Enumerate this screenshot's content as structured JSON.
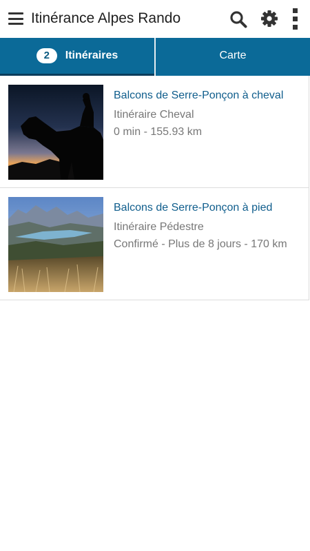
{
  "app": {
    "title": "Itinérance Alpes Rando",
    "icons": {
      "menu": "hamburger-menu-icon",
      "search": "search-icon",
      "settings": "gear-icon",
      "overflow": "more-vertical-icon"
    }
  },
  "tabs": {
    "itineraires": {
      "count": "2",
      "label": "Itinéraires"
    },
    "carte": {
      "label": "Carte"
    }
  },
  "routes": [
    {
      "title": "Balcons de Serre-Ponçon à cheval",
      "type": "Itinéraire Cheval",
      "meta": "0 min - 155.93 km"
    },
    {
      "title": "Balcons de Serre-Ponçon à pied",
      "type": "Itinéraire Pédestre",
      "meta": "Confirmé - Plus de 8 jours - 170 km"
    }
  ],
  "colors": {
    "tab_bar": "#0b6a98",
    "link_title": "#0f5d8c",
    "muted_text": "#777777"
  }
}
